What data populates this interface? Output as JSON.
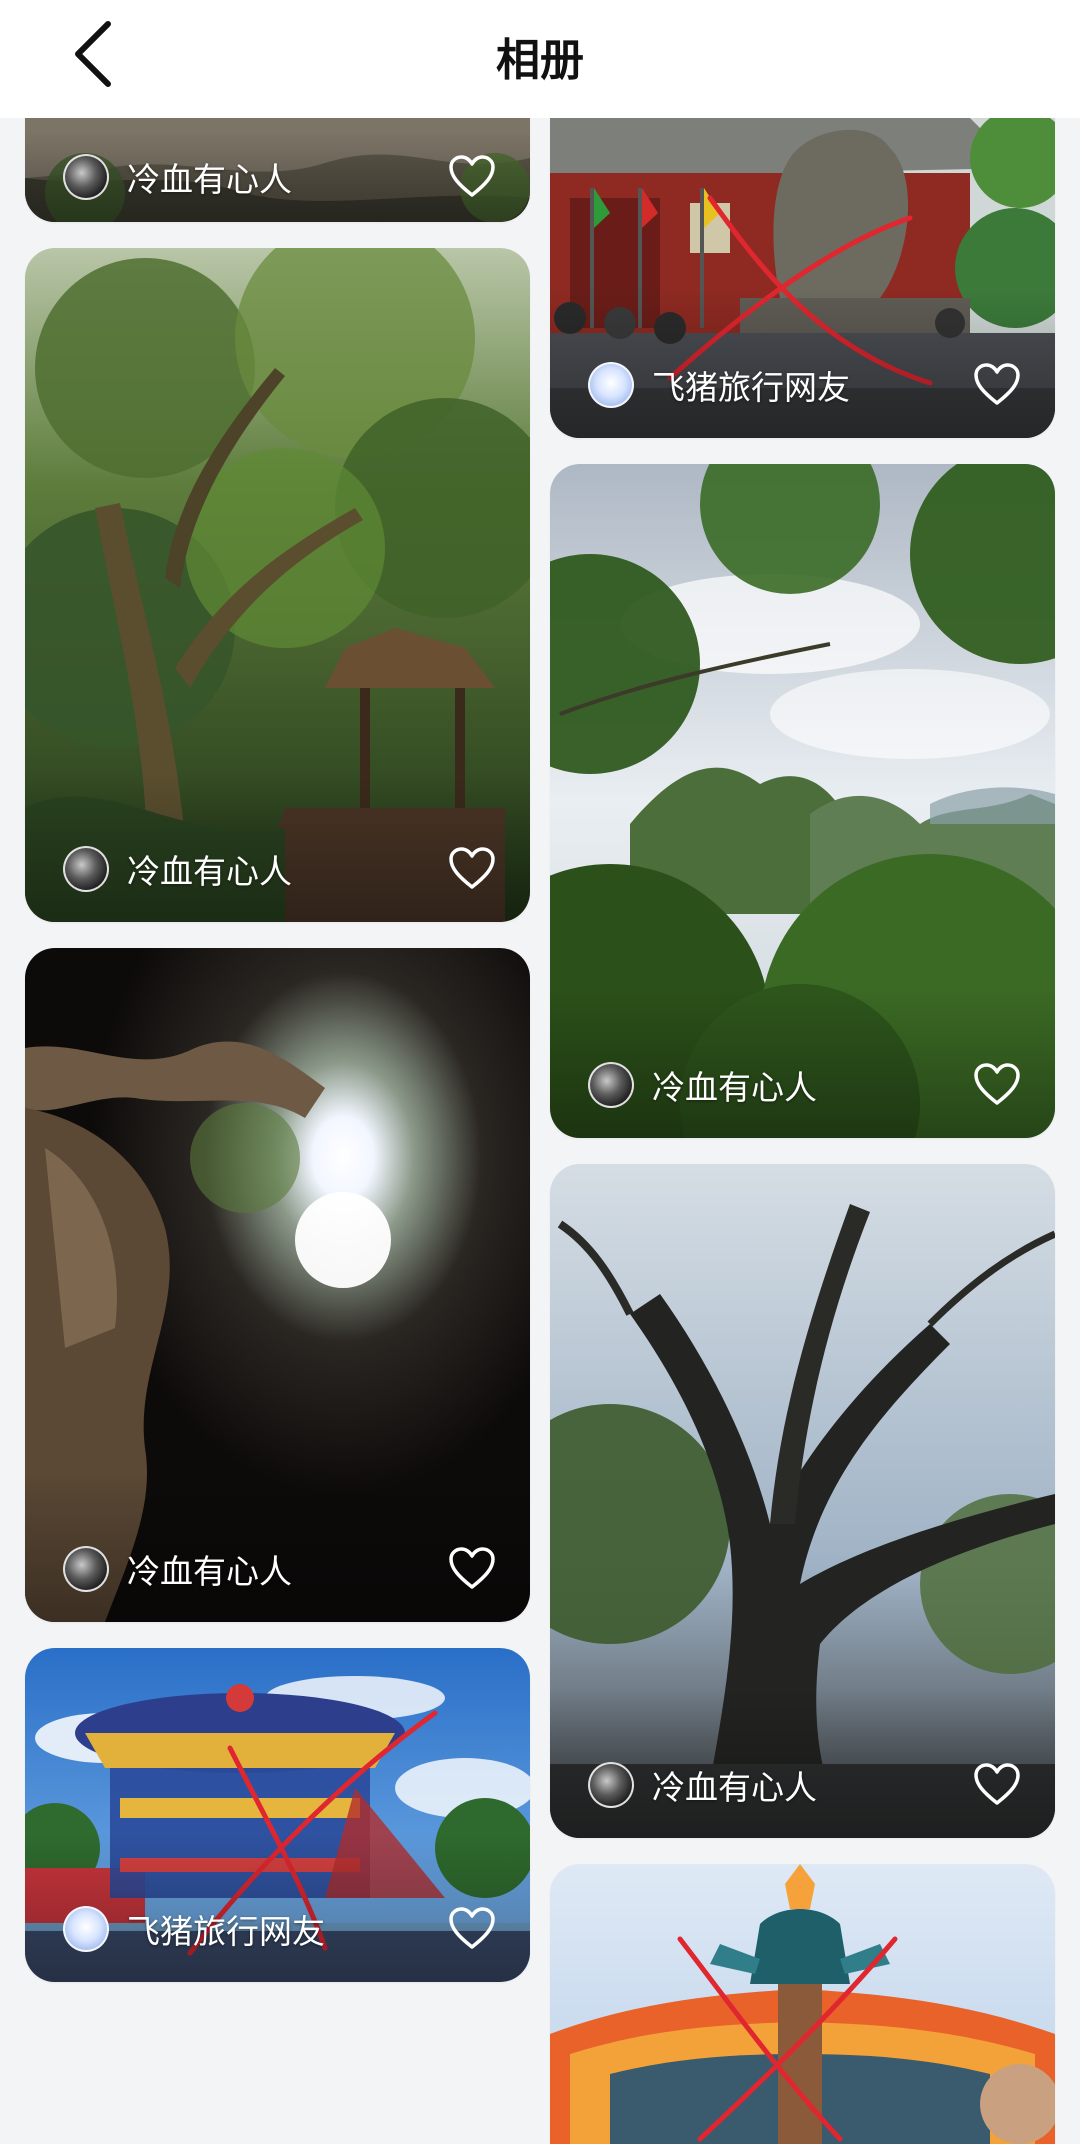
{
  "header": {
    "title": "相册",
    "back_icon": "chevron-left-icon"
  },
  "colors": {
    "cross_mark": "#e0262f",
    "heart": "#ffffff"
  },
  "cards": [
    {
      "author": "冷血有心人",
      "avatar": "dark",
      "scene": "rock-moss"
    },
    {
      "author": "冷血有心人",
      "avatar": "dark",
      "scene": "forest-pavilion"
    },
    {
      "author": "冷血有心人",
      "avatar": "dark",
      "scene": "cave-light"
    },
    {
      "author": "飞猪旅行网友",
      "avatar": "light",
      "scene": "carousel",
      "crossed_out": true
    },
    {
      "author": "飞猪旅行网友",
      "avatar": "light",
      "scene": "temple-lion",
      "crossed_out": true
    },
    {
      "author": "冷血有心人",
      "avatar": "dark",
      "scene": "karst-hills"
    },
    {
      "author": "冷血有心人",
      "avatar": "dark",
      "scene": "old-tree"
    },
    {
      "author": "",
      "scene": "totem-sculpture",
      "crossed_out": true
    }
  ]
}
